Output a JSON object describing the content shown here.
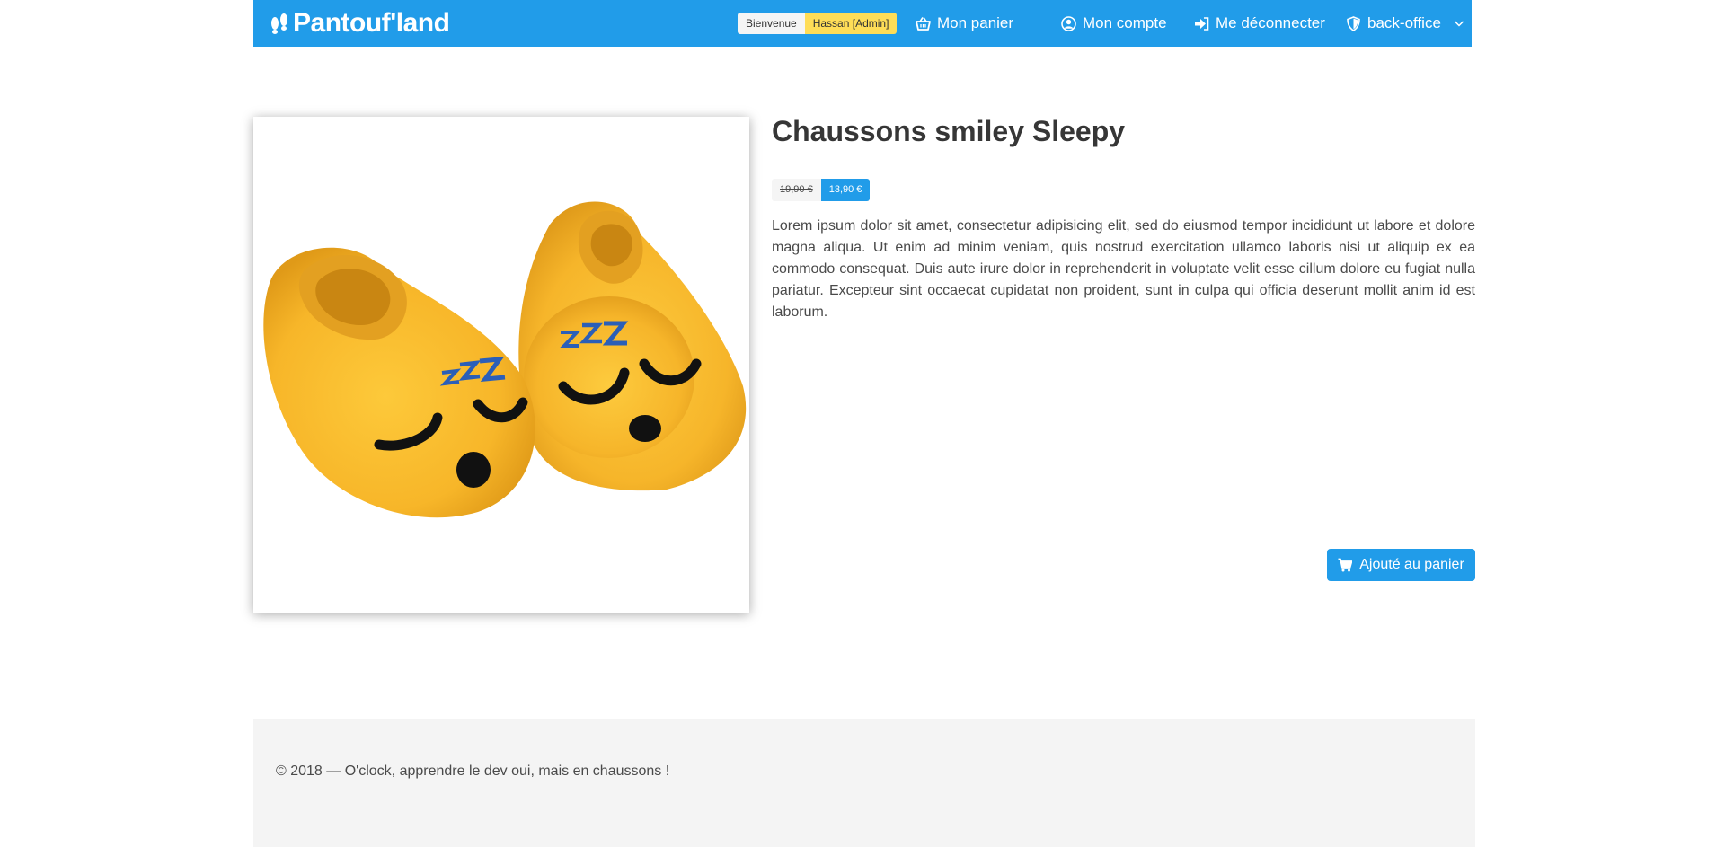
{
  "navbar": {
    "brand": "Pantouf'land",
    "welcome_tag": "Bienvenue",
    "user_tag": "Hassan [Admin]",
    "cart_label": "Mon panier",
    "account_label": "Mon compte",
    "logout_label": "Me déconnecter",
    "backoffice_label": "back-office",
    "icons": [
      "footprints-icon",
      "basket-icon",
      "user-circle-icon",
      "sign-out-icon",
      "shield-icon",
      "chevron-down-icon"
    ]
  },
  "product": {
    "title": "Chaussons smiley Sleepy",
    "old_price": "19,90 €",
    "new_price": "13,90 €",
    "description": "Lorem ipsum dolor sit amet, consectetur adipisicing elit, sed do eiusmod tempor incididunt ut labore et dolore magna aliqua. Ut enim ad minim veniam, quis nostrud exercitation ullamco laboris nisi ut aliquip ex ea commodo consequat. Duis aute irure dolor in reprehenderit in voluptate velit esse cillum dolore eu fugiat nulla pariatur. Excepteur sint occaecat cupidatat non proident, sunt in culpa qui officia deserunt mollit anim id est laborum.",
    "add_to_cart_label": "Ajouté au panier",
    "image_icon": "sleepy-emoji-slippers-image"
  },
  "footer": {
    "text": "© 2018 — O'clock, apprendre le dev oui, mais en chaussons !"
  },
  "colors": {
    "primary": "#219ce9",
    "warning": "#ffdd57",
    "light": "#f5f5f5",
    "footer_bg": "#f4f4f4",
    "slipper_yellow": "#f5bb2e"
  }
}
